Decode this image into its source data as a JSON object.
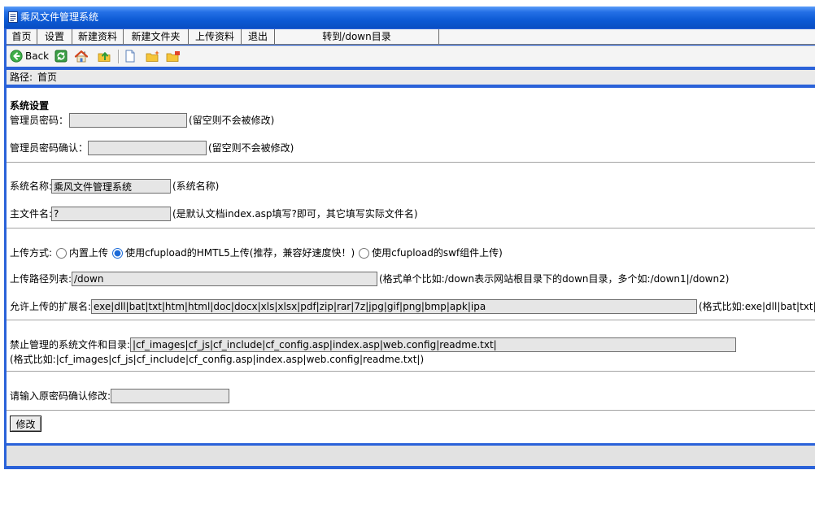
{
  "window": {
    "title": "乘风文件管理系统"
  },
  "menu": {
    "items": [
      "首页",
      "设置",
      "新建资料",
      "新建文件夹",
      "上传资料",
      "退出"
    ],
    "goto_label": "转到/down目录"
  },
  "toolbar": {
    "back_label": "Back",
    "icons": [
      "back-icon",
      "refresh-icon",
      "home-icon",
      "up-folder-icon",
      "new-file-icon",
      "new-folder-icon",
      "folder-icon"
    ]
  },
  "path": {
    "label": "路径:",
    "value": "首页"
  },
  "settings": {
    "heading": "系统设置",
    "admin_password": {
      "label": "管理员密码：",
      "value": "",
      "hint": "(留空则不会被修改)"
    },
    "admin_password_confirm": {
      "label": "管理员密码确认：",
      "value": "",
      "hint": "(留空则不会被修改)"
    },
    "system_name": {
      "label": "系统名称:",
      "value": "乘风文件管理系统",
      "hint": "(系统名称)"
    },
    "main_file": {
      "label": "主文件名:",
      "value": "?",
      "hint": "(是默认文档index.asp填写?即可，其它填写实际文件名)"
    },
    "upload_mode": {
      "label": "上传方式:",
      "options": [
        "内置上传",
        "使用cfupload的HMTL5上传(推荐，兼容好速度快！)",
        "使用cfupload的swf组件上传)"
      ],
      "selected": 1
    },
    "upload_paths": {
      "label": "上传路径列表:",
      "value": "/down",
      "hint": "(格式单个比如:/down表示网站根目录下的down目录，多个如:/down1|/down2)"
    },
    "allowed_extensions": {
      "label": "允许上传的扩展名:",
      "value": "exe|dll|bat|txt|htm|html|doc|docx|xls|xlsx|pdf|zip|rar|7z|jpg|gif|png|bmp|apk|ipa",
      "hint": "(格式比如:exe|dll|bat|txt|h"
    },
    "protected_files": {
      "label": "禁止管理的系统文件和目录:",
      "value": "|cf_images|cf_js|cf_include|cf_config.asp|index.asp|web.config|readme.txt|",
      "hint": "(格式比如:|cf_images|cf_js|cf_include|cf_config.asp|index.asp|web.config|readme.txt|)"
    },
    "confirm_old_password": {
      "label": "请输入原密码确认修改:",
      "value": ""
    },
    "submit_label": "修改"
  },
  "colors": {
    "frame_blue": "#2A62D9",
    "title_blue": "#0B58D3",
    "panel_gray": "#EAEAEA",
    "input_bg": "#E6E6E6",
    "footer_gray": "#E2E2E2"
  }
}
